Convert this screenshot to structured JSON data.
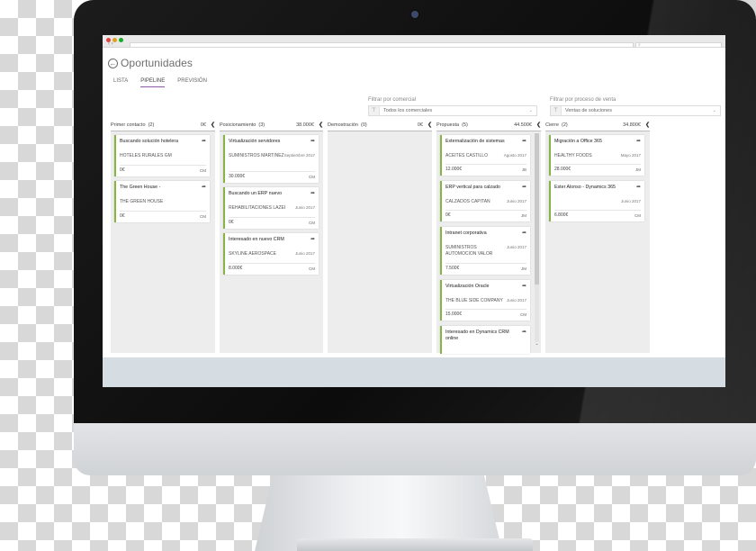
{
  "app": {
    "title": "Oportunidades",
    "search_icon": "search-icon",
    "nav_glyphs": "‹ ›"
  },
  "tabs": [
    {
      "label": "LISTA",
      "active": false
    },
    {
      "label": "PIPELINE",
      "active": true
    },
    {
      "label": "PREVISIÓN",
      "active": false
    }
  ],
  "filters": {
    "commercial": {
      "label": "Filtrar por comercial",
      "value": "Todos los comerciales"
    },
    "process": {
      "label": "Filtrar por proceso de venta",
      "value": "Ventas de soluciones"
    }
  },
  "columns": [
    {
      "name": "Primer contacto",
      "count": "(2)",
      "total": "0€",
      "cards": [
        {
          "title": "Buscando solución hotelera",
          "company": "HOTELES RURALES GM",
          "date": "",
          "amount": "0€",
          "owner": "CM"
        },
        {
          "title": "The Green House -",
          "company": "THE GREEN HOUSE",
          "date": "",
          "amount": "0€",
          "owner": "CM"
        }
      ]
    },
    {
      "name": "Posicionamiento",
      "count": "(3)",
      "total": "38.000€",
      "cards": [
        {
          "title": "Virtualización servidores",
          "company": "SUMINISTROS MARTINEZ",
          "date": "Septiembre 2017",
          "amount": "30.000€",
          "owner": "CM"
        },
        {
          "title": "Buscando un ERP nuevo",
          "company": "REHABILITACIONES LAZEI",
          "date": "Junio 2017",
          "amount": "0€",
          "owner": "CM"
        },
        {
          "title": "Interesado en nuevo CRM",
          "company": "SKYLINE AEROSPACE",
          "date": "Junio 2017",
          "amount": "8.000€",
          "owner": "CM"
        }
      ]
    },
    {
      "name": "Demostración",
      "count": "(0)",
      "total": "0€",
      "cards": []
    },
    {
      "name": "Propuesta",
      "count": "(5)",
      "total": "44.500€",
      "cards": [
        {
          "title": "Externalización de sistemas",
          "company": "ACEITES CASTILLO",
          "date": "Agosto 2017",
          "amount": "12.000€",
          "owner": "JB"
        },
        {
          "title": "ERP vertical para calzado",
          "company": "CALZADOS CAPITAN",
          "date": "Junio 2017",
          "amount": "0€",
          "owner": "JM"
        },
        {
          "title": "Intranet corporativa",
          "company": "SUMINISTROS AUTOMOCION VALOR",
          "date": "Junio 2017",
          "amount": "7.500€",
          "owner": "JM"
        },
        {
          "title": "Virtualización Oracle",
          "company": "THE BLUE SIDE COMPANY",
          "date": "Junio 2017",
          "amount": "15.000€",
          "owner": "CM"
        },
        {
          "title": "Interesado en Dynamics CRM online",
          "company": "",
          "date": "",
          "amount": "",
          "owner": ""
        }
      ]
    },
    {
      "name": "Cierre",
      "count": "(2)",
      "total": "34.800€",
      "cards": [
        {
          "title": "Migración a Office 365",
          "company": "HEALTHY FOODS",
          "date": "Mayo 2017",
          "amount": "28.000€",
          "owner": "JM"
        },
        {
          "title": "Ester Alonso - Dynamics 365",
          "company": "",
          "date": "Junio 2017",
          "amount": "6.800€",
          "owner": "CM"
        }
      ]
    }
  ],
  "glyphs": {
    "share": "➦",
    "collapse": "❮",
    "back": "←",
    "filter": "⊤",
    "chevron": "⌄",
    "scroll_down": "⌄"
  },
  "colors": {
    "accent_purple": "#8e5aa8",
    "card_border_green": "#86b544"
  }
}
